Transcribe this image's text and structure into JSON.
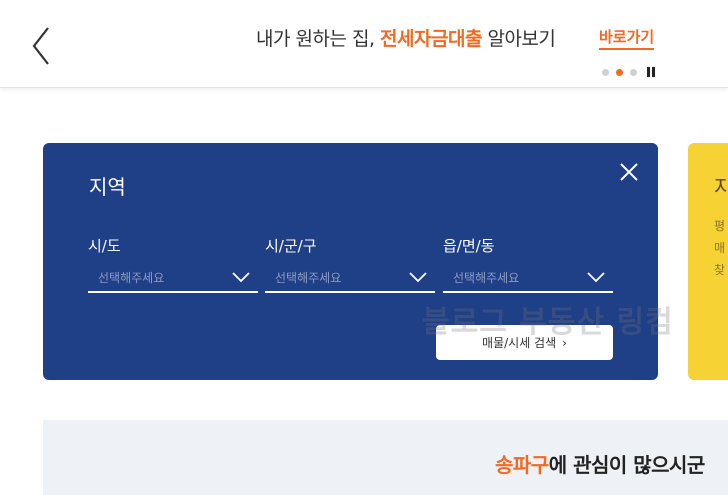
{
  "banner": {
    "text_before": "내가 원하는 집, ",
    "highlight": "전세자금대출",
    "text_after": " 알아보기",
    "shortcut_label": "바로가기",
    "slide_count": 3,
    "active_slide": 2
  },
  "region_card": {
    "title": "지역",
    "fields": [
      {
        "label": "시/도",
        "placeholder": "선택해주세요"
      },
      {
        "label": "시/군/구",
        "placeholder": "선택해주세요"
      },
      {
        "label": "읍/면/동",
        "placeholder": "선택해주세요"
      }
    ],
    "search_label": "매물/시세 검색",
    "search_arrow": "›"
  },
  "yellow_card": {
    "title": "지",
    "lines": [
      "평",
      "매",
      "찾"
    ]
  },
  "watermark": "블로그 부동산 링컴",
  "bottom": {
    "highlight": "송파구",
    "text": "에 관심이 많으시군"
  },
  "colors": {
    "accent": "#f26a21",
    "card_blue": "#1f3f87",
    "card_yellow": "#f7d234"
  },
  "icons": {
    "back": "chevron-left-icon",
    "close": "close-icon",
    "dropdown": "chevron-down-icon",
    "pause": "pause-icon"
  }
}
